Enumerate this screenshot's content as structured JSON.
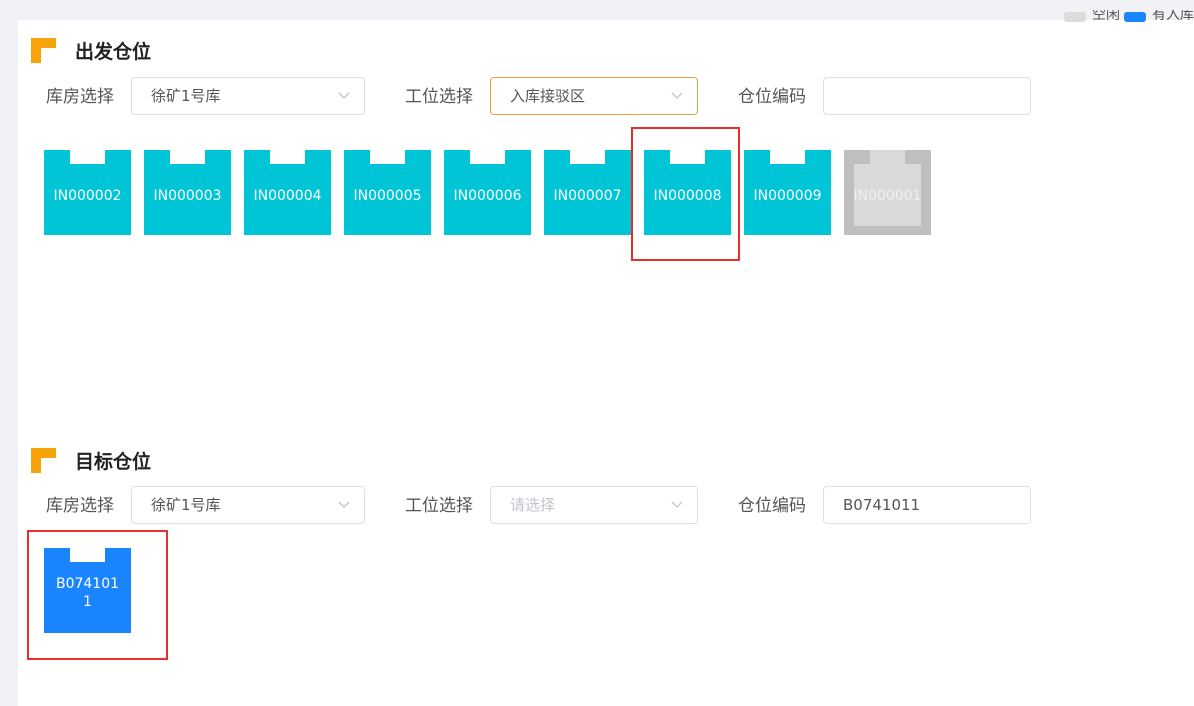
{
  "top_legend": {
    "item1_label": "空闲",
    "item1_color": "#dcdcdc",
    "item2_label": "有入库",
    "item2_color": "#1b85ff"
  },
  "source": {
    "title": "出发仓位",
    "warehouse_label": "库房选择",
    "warehouse_value": "徐矿1号库",
    "station_label": "工位选择",
    "station_value": "入库接驳区",
    "code_label": "仓位编码",
    "code_value": "",
    "slots": [
      {
        "code": "IN000002",
        "status": "available"
      },
      {
        "code": "IN000003",
        "status": "available"
      },
      {
        "code": "IN000004",
        "status": "available"
      },
      {
        "code": "IN000005",
        "status": "available"
      },
      {
        "code": "IN000006",
        "status": "available"
      },
      {
        "code": "IN000007",
        "status": "available"
      },
      {
        "code": "IN000008",
        "status": "selected"
      },
      {
        "code": "IN000009",
        "status": "available"
      },
      {
        "code": "IN000001",
        "status": "disabled"
      }
    ]
  },
  "target": {
    "title": "目标仓位",
    "warehouse_label": "库房选择",
    "warehouse_value": "徐矿1号库",
    "station_label": "工位选择",
    "station_placeholder": "请选择",
    "code_label": "仓位编码",
    "code_value": "B0741011",
    "slots": [
      {
        "code": "B0741011",
        "status": "selected"
      }
    ]
  },
  "colors": {
    "accent_orange": "#f7a40a",
    "slot_cyan": "#00c5d6",
    "slot_blue": "#1b85ff",
    "slot_disabled": "#bfbfbf",
    "highlight_red": "#e8302a"
  }
}
